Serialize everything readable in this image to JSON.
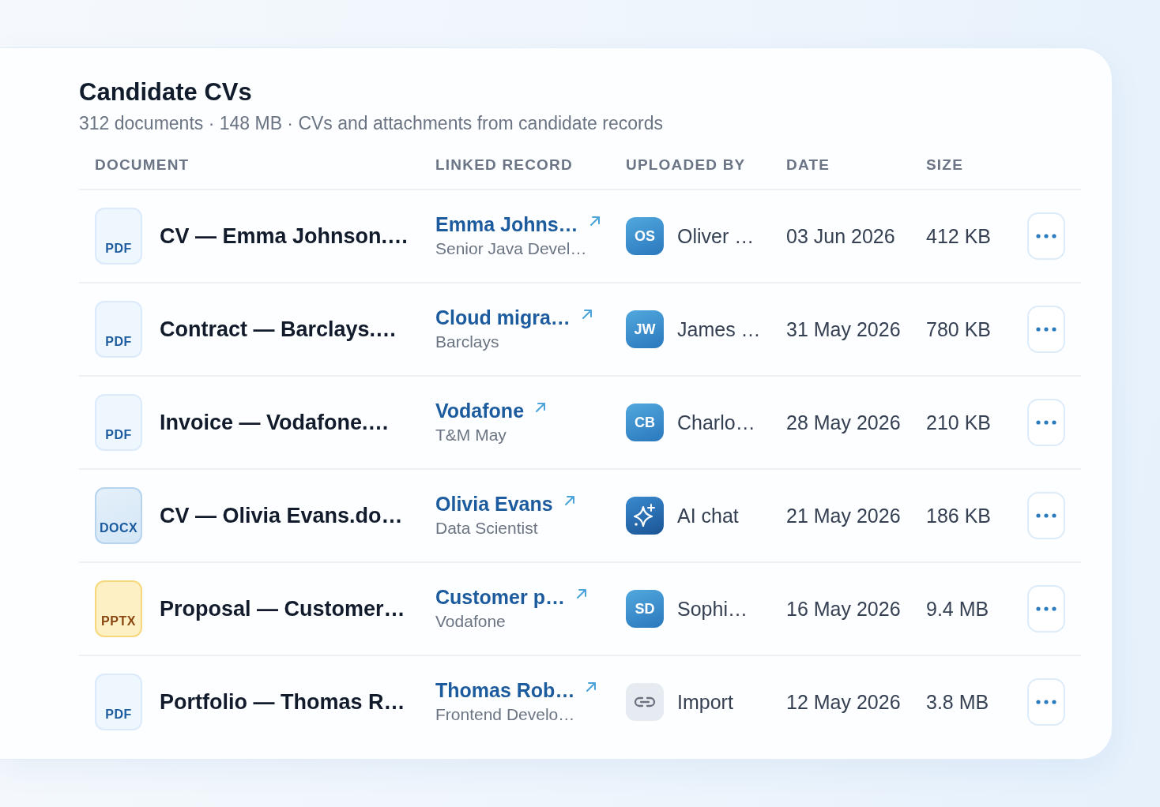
{
  "panel": {
    "title": "Candidate CVs",
    "subtitle": "312 documents · 148 MB · CVs and attachments from candidate records"
  },
  "table": {
    "columns": [
      "DOCUMENT",
      "LINKED RECORD",
      "UPLOADED BY",
      "DATE",
      "SIZE"
    ],
    "rows": [
      {
        "file": {
          "kind": "pdf",
          "label": "PDF"
        },
        "document": "CV — Emma Johnson.…",
        "linked_record": {
          "name": "Emma Johns…",
          "detail": "Senior Java Devel…"
        },
        "uploaded_by": {
          "kind": "user",
          "initials": "OS",
          "name": "Oliver …"
        },
        "date": "03 Jun 2026",
        "size": "412 KB"
      },
      {
        "file": {
          "kind": "pdf",
          "label": "PDF"
        },
        "document": "Contract — Barclays.…",
        "linked_record": {
          "name": "Cloud migra…",
          "detail": "Barclays"
        },
        "uploaded_by": {
          "kind": "user",
          "initials": "JW",
          "name": "James …"
        },
        "date": "31 May 2026",
        "size": "780 KB"
      },
      {
        "file": {
          "kind": "pdf",
          "label": "PDF"
        },
        "document": "Invoice — Vodafone.…",
        "linked_record": {
          "name": "Vodafone",
          "detail": "T&M May"
        },
        "uploaded_by": {
          "kind": "user",
          "initials": "CB",
          "name": "Charlo…"
        },
        "date": "28 May 2026",
        "size": "210 KB"
      },
      {
        "file": {
          "kind": "docx",
          "label": "DOCX"
        },
        "document": "CV — Olivia Evans.do…",
        "linked_record": {
          "name": "Olivia Evans",
          "detail": "Data Scientist"
        },
        "uploaded_by": {
          "kind": "ai",
          "name": "AI chat"
        },
        "date": "21 May 2026",
        "size": "186 KB"
      },
      {
        "file": {
          "kind": "pptx",
          "label": "PPTX"
        },
        "document": "Proposal — Customer…",
        "linked_record": {
          "name": "Customer p…",
          "detail": "Vodafone"
        },
        "uploaded_by": {
          "kind": "user",
          "initials": "SD",
          "name": "Sophi…"
        },
        "date": "16 May 2026",
        "size": "9.4 MB"
      },
      {
        "file": {
          "kind": "pdf",
          "label": "PDF"
        },
        "document": "Portfolio — Thomas R…",
        "linked_record": {
          "name": "Thomas Rob…",
          "detail": "Frontend Develo…"
        },
        "uploaded_by": {
          "kind": "import",
          "name": "Import"
        },
        "date": "12 May 2026",
        "size": "3.8 MB"
      }
    ]
  }
}
